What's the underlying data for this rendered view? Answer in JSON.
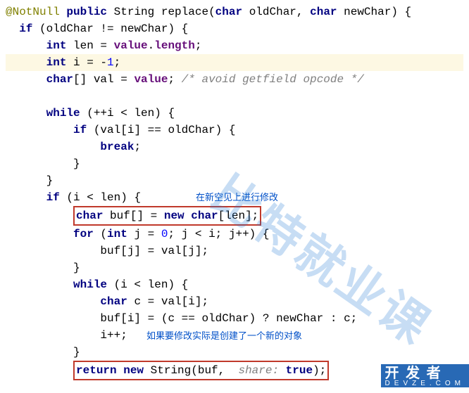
{
  "code": {
    "l1_ann": "@NotNull ",
    "l1_pub": "public ",
    "l1_str": "String replace(",
    "l1_char1": "char ",
    "l1_p1": "oldChar, ",
    "l1_char2": "char ",
    "l1_p2": "newChar) {",
    "l2_a": "  ",
    "l2_if": "if ",
    "l2_b": "(oldChar != newChar) {",
    "l3_a": "      ",
    "l3_int": "int ",
    "l3_b": "len = ",
    "l3_val": "value",
    "l3_c": ".",
    "l3_len": "length",
    "l3_d": ";",
    "l4_a": "      ",
    "l4_int": "int ",
    "l4_b": "i = ",
    "l4_neg": "-",
    "l4_num": "1",
    "l4_c": ";",
    "l5_a": "      ",
    "l5_char": "char",
    "l5_b": "[] val = ",
    "l5_val": "value",
    "l5_c": "; ",
    "l5_cmt": "/* avoid getfield opcode */",
    "l7_a": "      ",
    "l7_while": "while ",
    "l7_b": "(++i < len) {",
    "l8_a": "          ",
    "l8_if": "if ",
    "l8_b": "(val[i] == oldChar) {",
    "l9_a": "              ",
    "l9_break": "break",
    "l9_b": ";",
    "l10": "          }",
    "l11": "      }",
    "l12_a": "      ",
    "l12_if": "if ",
    "l12_b": "(i < len) {",
    "l13_a": "          ",
    "l13_char": "char ",
    "l13_b": "buf[] = ",
    "l13_new": "new char",
    "l13_c": "[len];",
    "l14_a": "          ",
    "l14_for": "for ",
    "l14_b": "(",
    "l14_int": "int ",
    "l14_c": "j = ",
    "l14_zero": "0",
    "l14_d": "; j < i; j++) {",
    "l15": "              buf[j] = val[j];",
    "l16": "          }",
    "l17_a": "          ",
    "l17_while": "while ",
    "l17_b": "(i < len) {",
    "l18_a": "              ",
    "l18_char": "char ",
    "l18_b": "c = val[i];",
    "l19": "              buf[i] = (c == oldChar) ? newChar : c;",
    "l20": "              i++;",
    "l21": "          }",
    "l22_a": "          ",
    "l22_ret": "return new ",
    "l22_b": "String(buf, ",
    "l22_share": " share: ",
    "l22_true": "true",
    "l22_c": ");"
  },
  "notes": {
    "n1": "在新空见上进行修改",
    "n2": "如果要修改实际是创建了一个新的对象"
  },
  "watermark": {
    "main": "比特就业课",
    "brand_top": "开 发 者",
    "brand_sub": "DEVZE.COM"
  }
}
